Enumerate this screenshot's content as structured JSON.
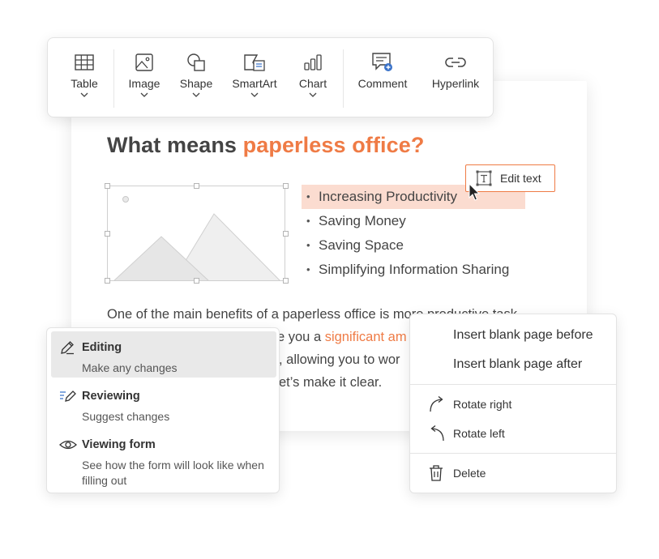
{
  "toolbar": {
    "items": [
      {
        "label": "Table",
        "icon": "table-icon",
        "has_dropdown": true
      },
      {
        "label": "Image",
        "icon": "image-icon",
        "has_dropdown": true
      },
      {
        "label": "Shape",
        "icon": "shape-icon",
        "has_dropdown": true
      },
      {
        "label": "SmartArt",
        "icon": "smartart-icon",
        "has_dropdown": true
      },
      {
        "label": "Chart",
        "icon": "chart-icon",
        "has_dropdown": true
      },
      {
        "label": "Comment",
        "icon": "comment-icon",
        "has_dropdown": false
      },
      {
        "label": "Hyperlink",
        "icon": "link-icon",
        "has_dropdown": false
      }
    ]
  },
  "document": {
    "title_prefix": "What means ",
    "title_accent": "paperless office?",
    "bullets": [
      "Increasing Productivity",
      "Saving Money",
      "Saving Space",
      "Simplifying Information Sharing"
    ],
    "selected_bullet": 0,
    "edit_text_label": "Edit text",
    "para_line1": "One of the main benefits of a paperless office is more productive task",
    "para_line2_a": "e you a ",
    "para_line2_accent": "significant am",
    "para_line3": ", allowing you to wor",
    "para_line4": "et’s make it clear."
  },
  "mode_menu": {
    "items": [
      {
        "title": "Editing",
        "desc": "Make any changes",
        "icon": "pencil-icon",
        "active": true
      },
      {
        "title": "Reviewing",
        "desc": "Suggest changes",
        "icon": "review-pen-icon",
        "active": false
      },
      {
        "title": "Viewing form",
        "desc": "See how the form will look like when filling out",
        "icon": "eye-icon",
        "active": false
      }
    ]
  },
  "context_menu": {
    "insert_before": "Insert blank page before",
    "insert_after": "Insert blank page after",
    "rotate_right": "Rotate right",
    "rotate_left": "Rotate left",
    "delete": "Delete"
  },
  "colors": {
    "accent": "#ef7b45",
    "highlight": "#fbdcd0",
    "active_item": "#e9e9e9"
  }
}
